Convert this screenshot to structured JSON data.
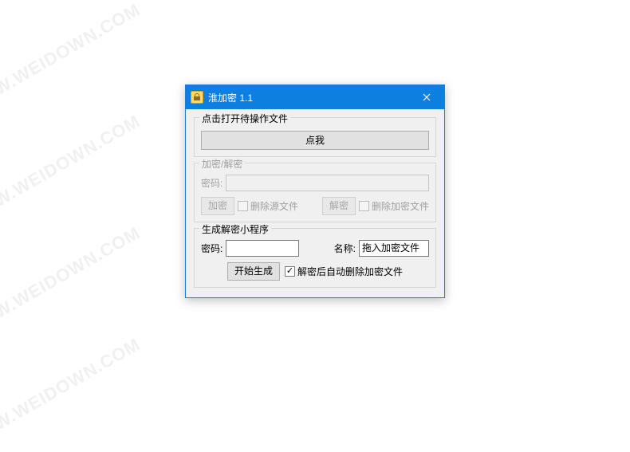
{
  "watermark_text": "WWW.WEIDOWN.COM",
  "titlebar": {
    "title": "淮加密 1.1"
  },
  "section_open_file": {
    "group_label": "点击打开待操作文件",
    "button_label": "点我"
  },
  "section_crypt": {
    "group_label": "加密/解密",
    "password_label": "密码:",
    "password_value": "",
    "encrypt_btn": "加密",
    "delete_source_chk": "删除源文件",
    "decrypt_btn": "解密",
    "delete_encrypted_chk": "删除加密文件"
  },
  "section_gen": {
    "group_label": "生成解密小程序",
    "password_label": "密码:",
    "password_value": "",
    "name_label": "名称:",
    "name_value": "拖入加密文件",
    "generate_btn": "开始生成",
    "auto_delete_chk": "解密后自动删除加密文件",
    "auto_delete_checked": true
  }
}
